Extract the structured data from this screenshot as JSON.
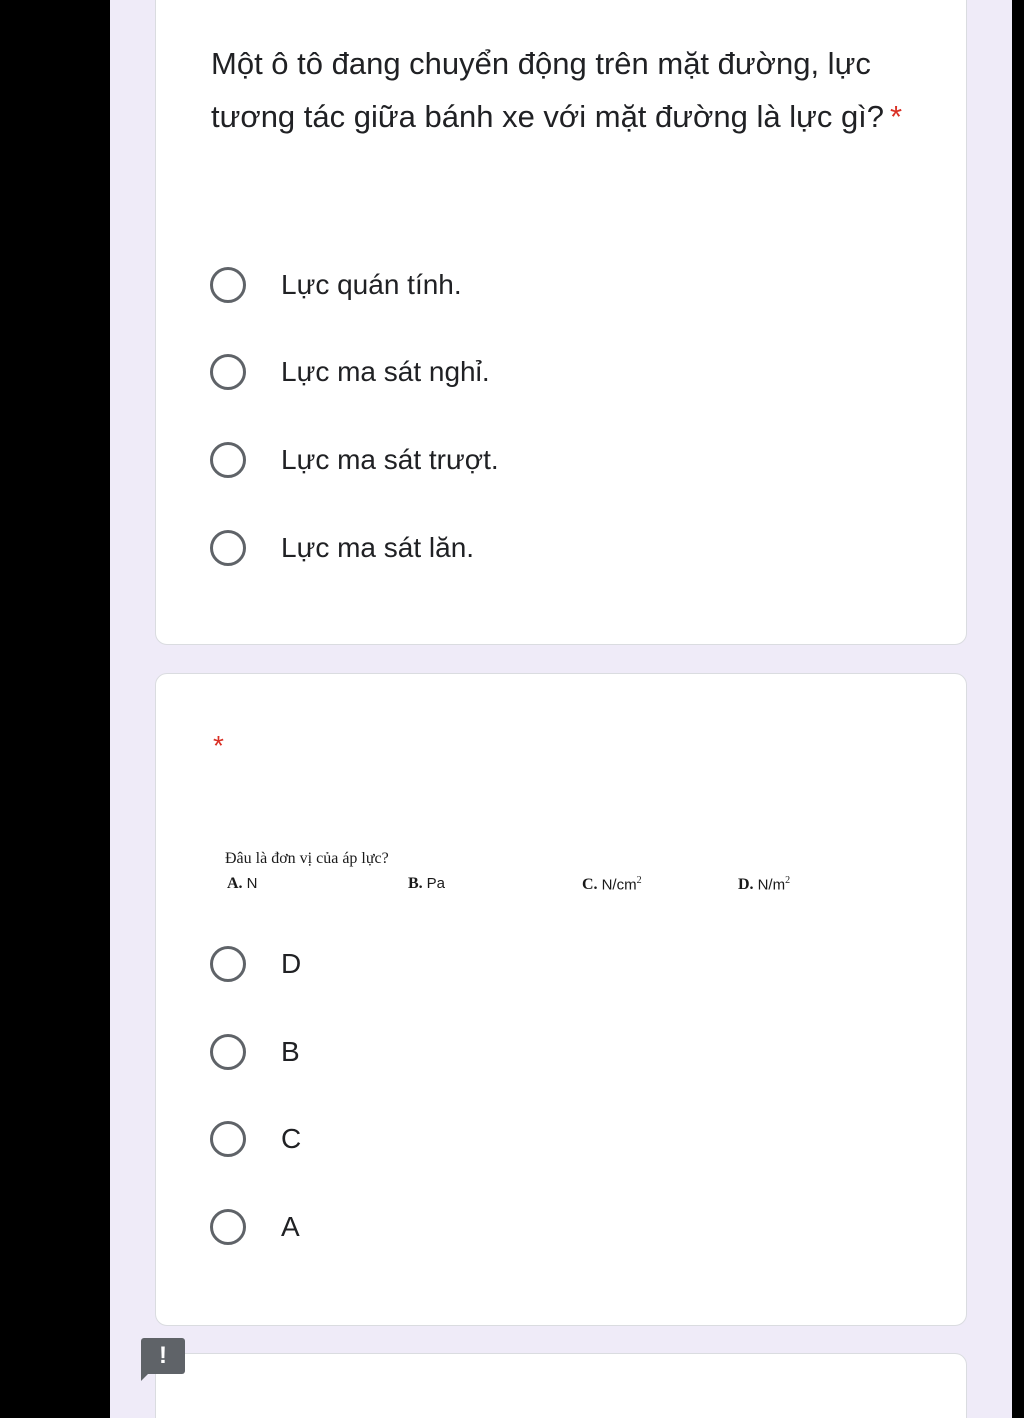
{
  "question1": {
    "title": "Một ô tô đang chuyển động trên mặt đường, lực tương tác giữa bánh xe với mặt đường là lực gì?",
    "required_mark": "*",
    "options": [
      {
        "label": "Lực quán tính."
      },
      {
        "label": "Lực ma sát nghỉ."
      },
      {
        "label": "Lực ma sát trượt."
      },
      {
        "label": "Lực ma sát lăn."
      }
    ]
  },
  "question2": {
    "required_mark": "*",
    "image": {
      "question_text": "Đâu là đơn vị của áp lực?",
      "choices": [
        {
          "letter": "A.",
          "unit": "N",
          "sup": ""
        },
        {
          "letter": "B.",
          "unit": "Pa",
          "sup": ""
        },
        {
          "letter": "C.",
          "unit": "N/cm",
          "sup": "2"
        },
        {
          "letter": "D.",
          "unit": "N/m",
          "sup": "2"
        }
      ]
    },
    "options": [
      {
        "label": "D"
      },
      {
        "label": "B"
      },
      {
        "label": "C"
      },
      {
        "label": "A"
      }
    ]
  },
  "alert_badge": {
    "text": "!"
  },
  "colors": {
    "background": "#efebf8",
    "card": "#ffffff",
    "required": "#d93025",
    "radio_border": "#5f6368",
    "text": "#202124"
  }
}
